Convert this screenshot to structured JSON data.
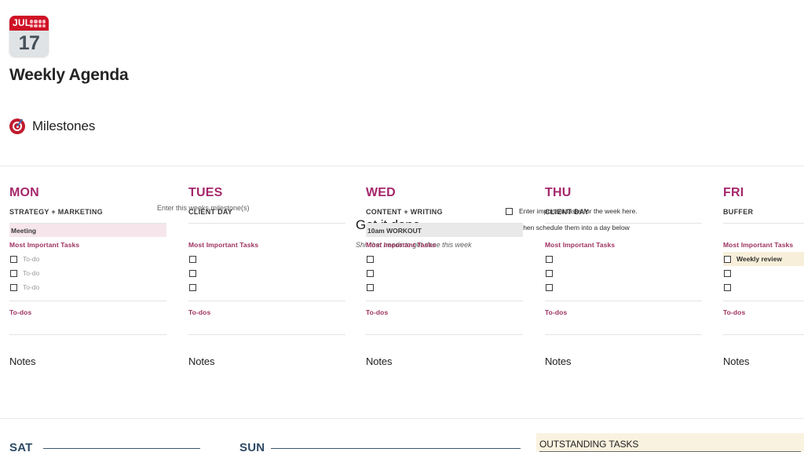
{
  "header": {
    "calendar_icon": {
      "month": "JUL",
      "day": "17",
      "icon_name": "calendar-icon"
    },
    "title": "Weekly Agenda"
  },
  "top_band": {
    "milestones": {
      "icon_name": "target-icon",
      "label": "Milestones",
      "hint": "Enter this weeks milestone(s)"
    },
    "get_it_done": {
      "title": "Get it done",
      "subtitle": "Shit that needs to get done this week",
      "hints": [
        {
          "label": "Enter important tasks for the week here.",
          "checked": false
        },
        {
          "label": "Then schedule them into a day below",
          "checked": false
        }
      ]
    }
  },
  "days": [
    {
      "name": "MON",
      "theme": "STRATEGY + MARKETING",
      "highlight": {
        "text": "Meeting",
        "style": "pink"
      },
      "mit_label": "Most Important Tasks",
      "todos": [
        {
          "text": "To-do",
          "checked": false,
          "highlight": "none"
        },
        {
          "text": "To-do",
          "checked": false,
          "highlight": "none"
        },
        {
          "text": "To-do",
          "checked": false,
          "highlight": "none"
        }
      ],
      "todos_label": "To-dos",
      "notes_label": "Notes"
    },
    {
      "name": "TUES",
      "theme": "CLIENT DAY",
      "highlight": {
        "text": "",
        "style": "empty"
      },
      "mit_label": "Most Important Tasks",
      "todos": [
        {
          "text": "",
          "checked": false,
          "highlight": "none"
        },
        {
          "text": "",
          "checked": false,
          "highlight": "none"
        },
        {
          "text": "",
          "checked": false,
          "highlight": "none"
        }
      ],
      "todos_label": "To-dos",
      "notes_label": "Notes"
    },
    {
      "name": "WED",
      "theme": "CONTENT + WRITING",
      "highlight": {
        "text": "10am WORKOUT",
        "style": "grey"
      },
      "mit_label": "Most Important Tasks",
      "todos": [
        {
          "text": "",
          "checked": false,
          "highlight": "none"
        },
        {
          "text": "",
          "checked": false,
          "highlight": "none"
        },
        {
          "text": "",
          "checked": false,
          "highlight": "none"
        }
      ],
      "todos_label": "To-dos",
      "notes_label": "Notes"
    },
    {
      "name": "THU",
      "theme": "CLIENT DAY",
      "highlight": {
        "text": "",
        "style": "empty"
      },
      "mit_label": "Most Important Tasks",
      "todos": [
        {
          "text": "",
          "checked": false,
          "highlight": "none"
        },
        {
          "text": "",
          "checked": false,
          "highlight": "none"
        },
        {
          "text": "",
          "checked": false,
          "highlight": "none"
        }
      ],
      "todos_label": "To-dos",
      "notes_label": "Notes"
    },
    {
      "name": "FRI",
      "theme": "BUFFER",
      "highlight": {
        "text": "",
        "style": "empty"
      },
      "mit_label": "Most Important Tasks",
      "todos": [
        {
          "text": "Weekly review",
          "checked": false,
          "highlight": "cream"
        },
        {
          "text": "",
          "checked": false,
          "highlight": "none"
        },
        {
          "text": "",
          "checked": false,
          "highlight": "none"
        }
      ],
      "todos_label": "To-dos",
      "notes_label": "Notes"
    }
  ],
  "bottom": {
    "weekend": [
      {
        "name": "SAT"
      },
      {
        "name": "SUN"
      }
    ],
    "outstanding": {
      "title": "OUTSTANDING TASKS"
    }
  },
  "colors": {
    "day_heading": "#a5276b",
    "accent_pink": "#9e3361",
    "calendar_red": "#cf1225",
    "weekend_blue": "#2e4a66",
    "highlight_pink": "#f6e6ec",
    "highlight_grey": "#e9e9e9",
    "highlight_cream": "#f7efd9",
    "outstanding_bg": "#faf2e0"
  }
}
